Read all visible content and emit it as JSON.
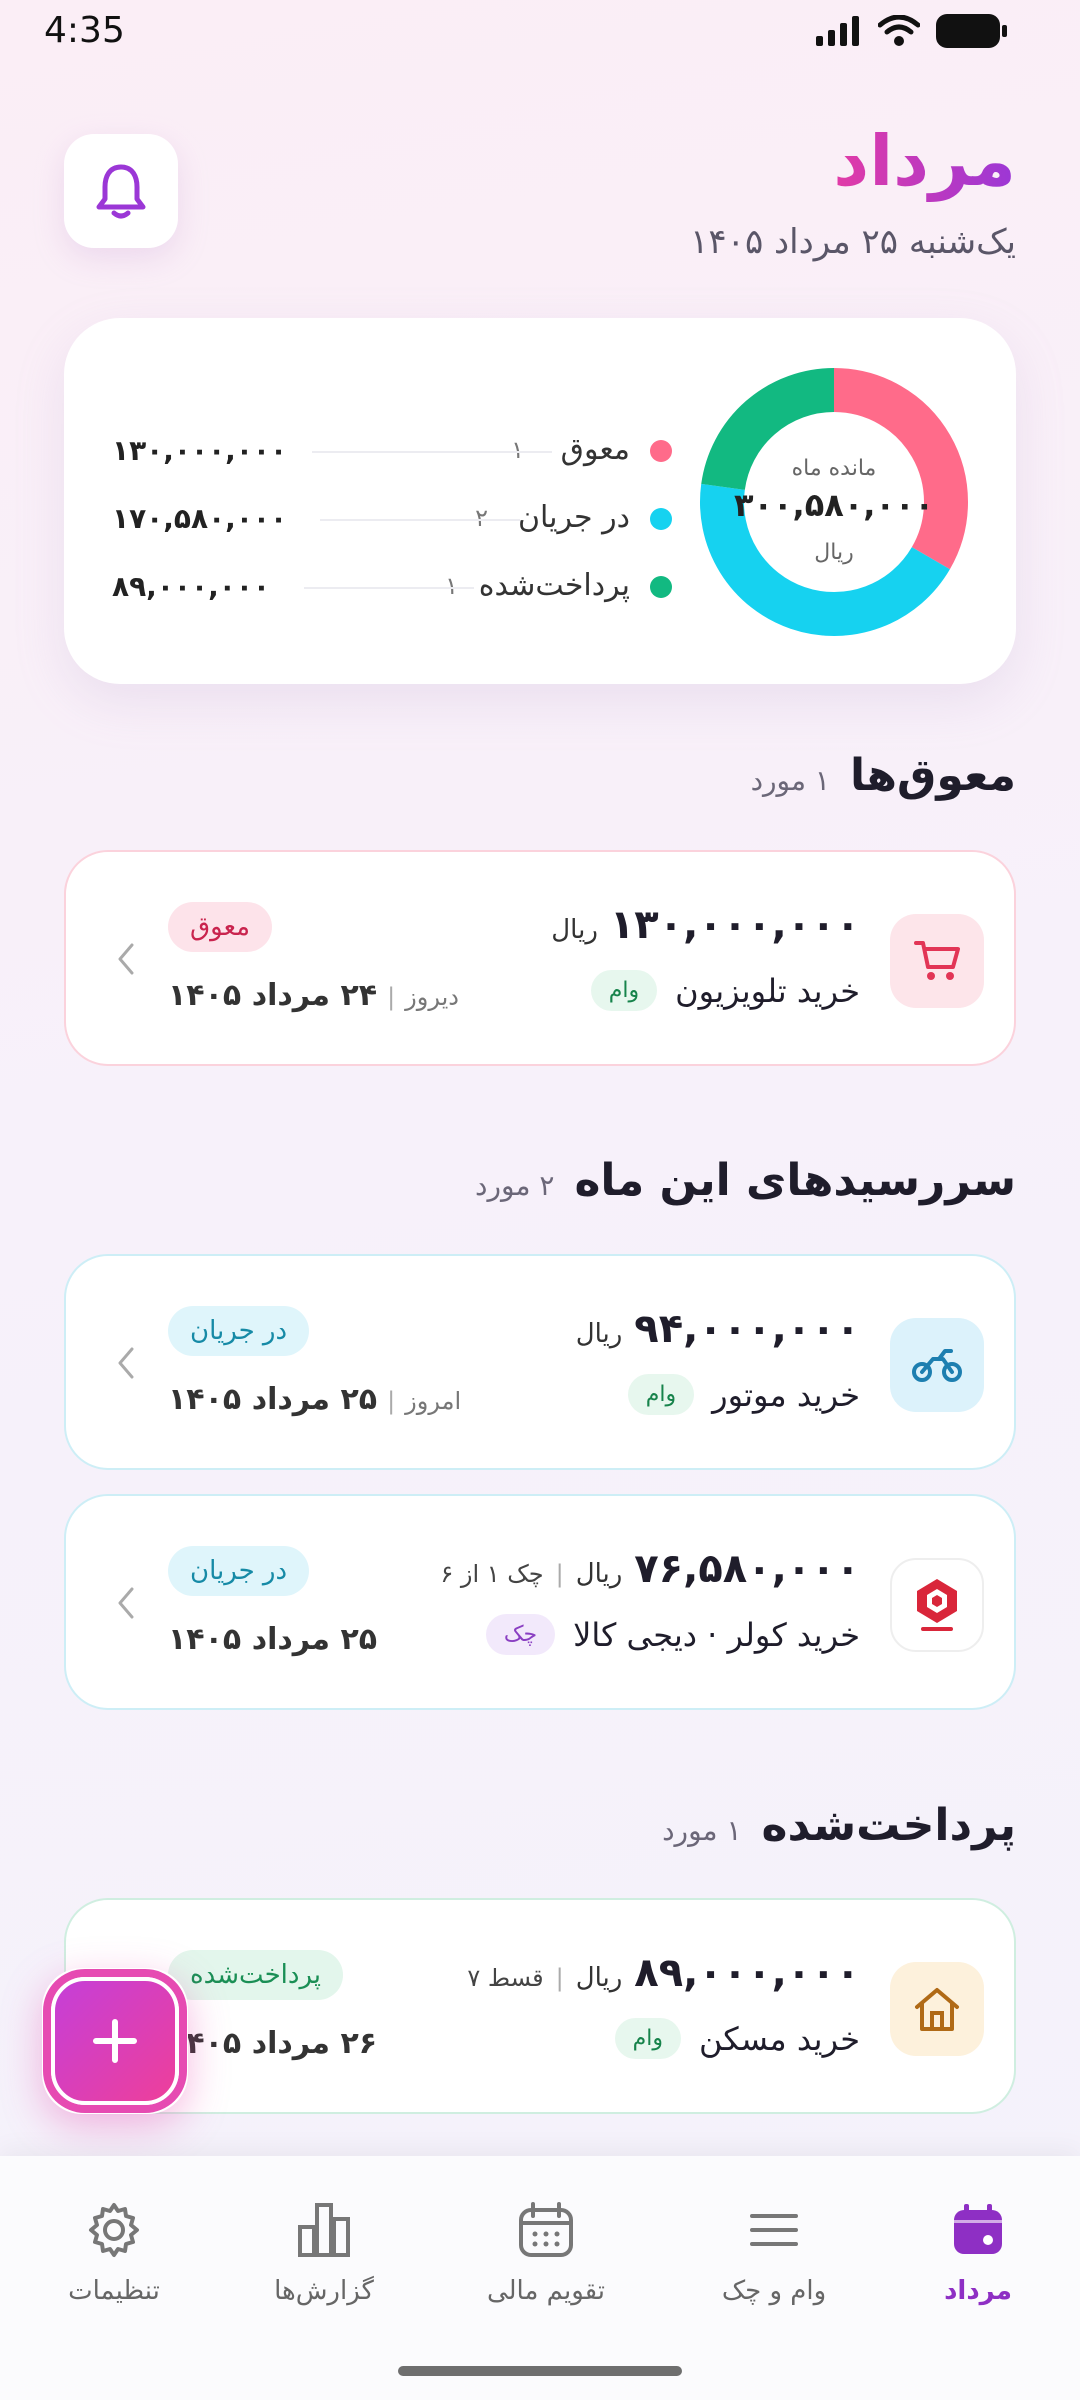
{
  "status_bar": {
    "time": "4:35"
  },
  "header": {
    "title": "مرداد",
    "date": "یک‌شنبه ۲۵ مرداد ۱۴۰۵"
  },
  "summary": {
    "center_label": "مانده ماه",
    "center_value": "۳۰۰,۵۸۰,۰۰۰",
    "center_unit": "ریال",
    "legend": [
      {
        "label": "معوق",
        "count": "۱",
        "amount": "۱۳۰,۰۰۰,۰۰۰",
        "color": "#ff6b8a"
      },
      {
        "label": "در جریان",
        "count": "۲",
        "amount": "۱۷۰,۵۸۰,۰۰۰",
        "color": "#16d2f0"
      },
      {
        "label": "پرداخت‌شده",
        "count": "۱",
        "amount": "۸۹,۰۰۰,۰۰۰",
        "color": "#12b981"
      }
    ],
    "chart_data": {
      "type": "pie",
      "categories": [
        "معوق",
        "در جریان",
        "پرداخت‌شده"
      ],
      "values": [
        130000000,
        170580000,
        89000000
      ]
    }
  },
  "sections": {
    "overdue": {
      "title": "معوق‌ها",
      "count": "۱ مورد"
    },
    "due": {
      "title": "سررسیدهای این ماه",
      "count": "۲ مورد"
    },
    "paid": {
      "title": "پرداخت‌شده",
      "count": "۱ مورد"
    }
  },
  "cards": [
    {
      "amount": "۱۳۰,۰۰۰,۰۰۰",
      "unit": "ریال",
      "extra": "",
      "name": "خرید تلویزیون",
      "tag": "وام",
      "status": "معوق",
      "date_prefix": "دیروز",
      "date": "۲۴ مرداد ۱۴۰۵",
      "icon": "cart-icon"
    },
    {
      "amount": "۹۴,۰۰۰,۰۰۰",
      "unit": "ریال",
      "extra": "",
      "name": "خرید موتور",
      "tag": "وام",
      "status": "در جریان",
      "date_prefix": "امروز",
      "date": "۲۵ مرداد ۱۴۰۵",
      "icon": "motorcycle-icon"
    },
    {
      "amount": "۷۶,۵۸۰,۰۰۰",
      "unit": "ریال",
      "extra": "چک ۱ از ۶",
      "name": "خرید کولر · دیجی کالا",
      "tag": "چک",
      "status": "در جریان",
      "date_prefix": "",
      "date": "۲۵ مرداد ۱۴۰۵",
      "icon": "bank-mellat-logo"
    },
    {
      "amount": "۸۹,۰۰۰,۰۰۰",
      "unit": "ریال",
      "extra": "قسط ۷",
      "name": "خرید مسکن",
      "tag": "وام",
      "status": "پرداخت‌شده",
      "date_prefix": "",
      "date": "۲۶ مرداد ۱۴۰۵",
      "icon": "house-icon"
    }
  ],
  "nav": [
    {
      "label": "مرداد",
      "icon": "calendar-icon",
      "active": true
    },
    {
      "label": "وام و چک",
      "icon": "menu-icon"
    },
    {
      "label": "تقویم مالی",
      "icon": "calendar-grid-icon"
    },
    {
      "label": "گزارش‌ها",
      "icon": "bar-chart-icon"
    },
    {
      "label": "تنظیمات",
      "icon": "gear-icon"
    }
  ]
}
